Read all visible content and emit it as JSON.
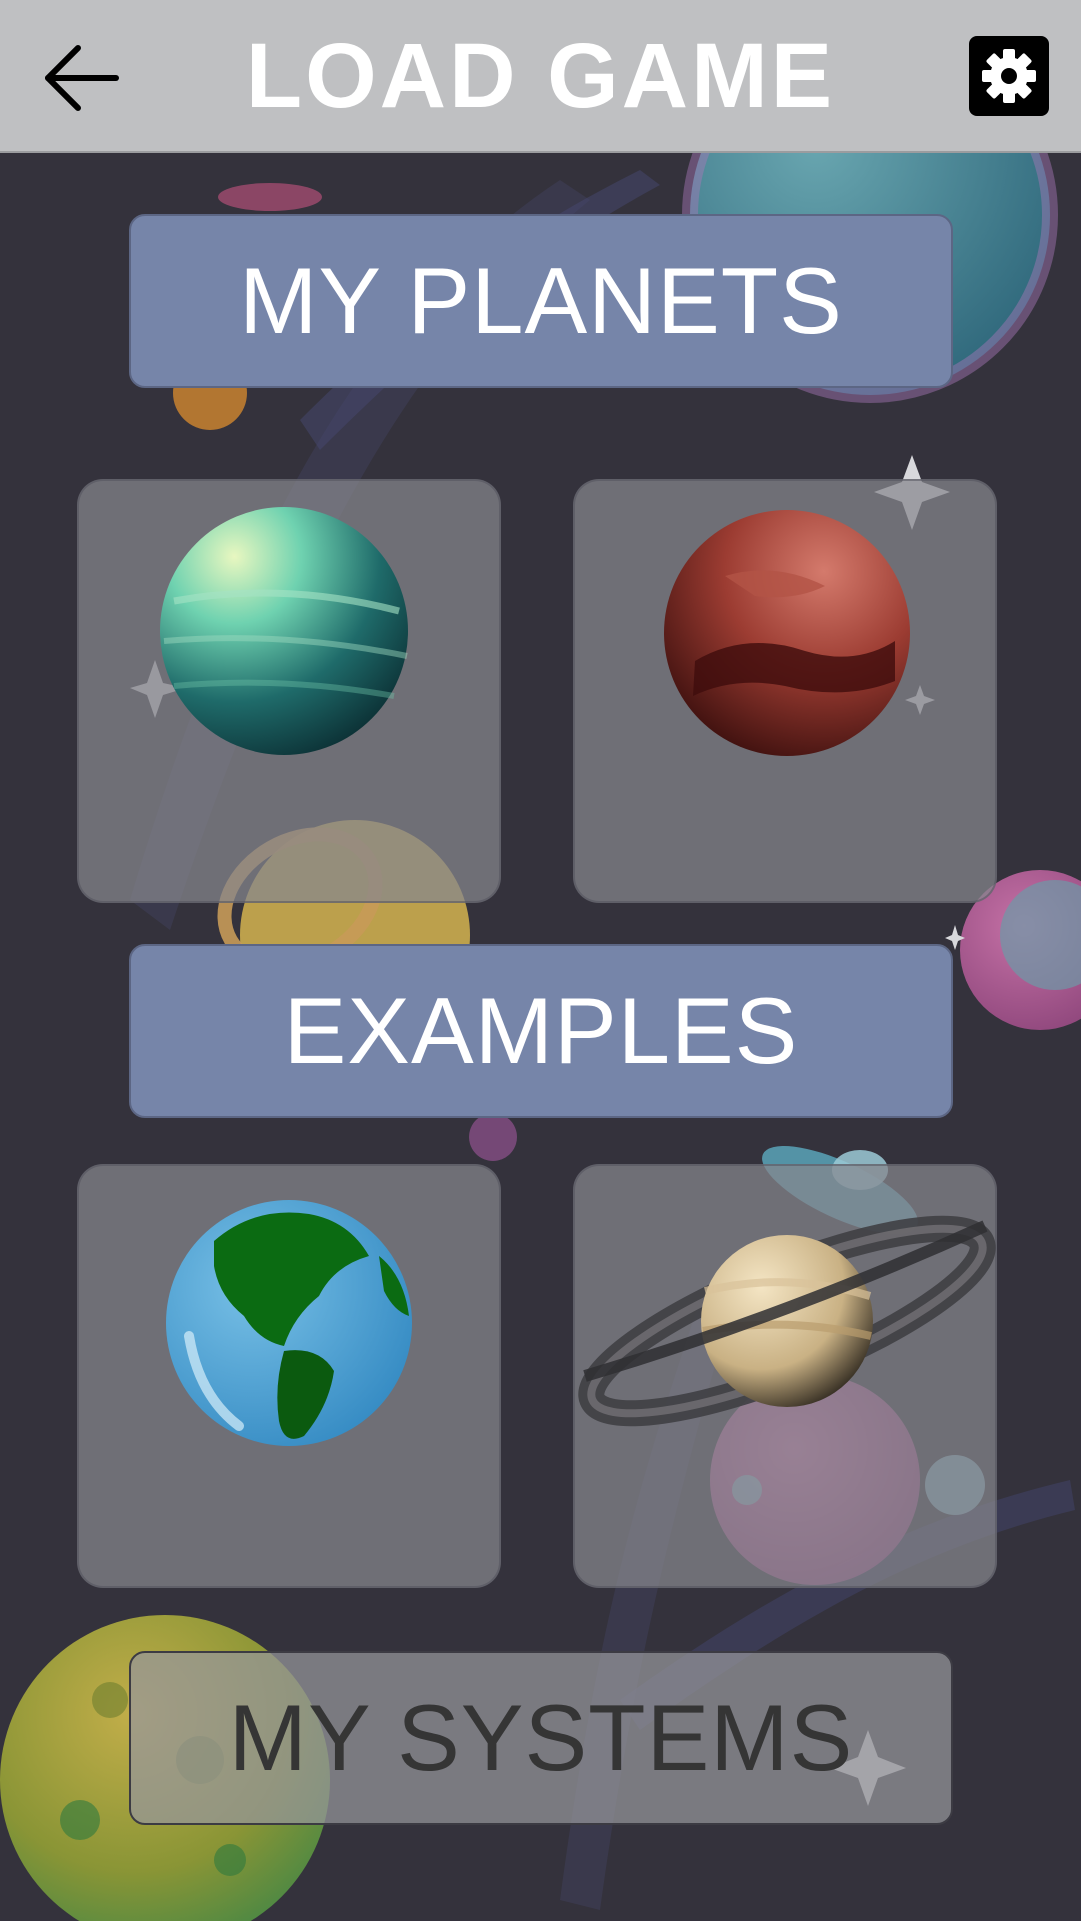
{
  "header": {
    "title": "LOAD GAME",
    "back_icon": "arrow-left-icon",
    "settings_icon": "gear-icon"
  },
  "sections": {
    "my_planets": "MY PLANETS",
    "examples": "EXAMPLES",
    "my_systems": "MY SYSTEMS"
  },
  "my_planets_cards": [
    {
      "icon": "teal-gas-planet-icon"
    },
    {
      "icon": "red-rocky-planet-icon"
    }
  ],
  "example_cards": [
    {
      "icon": "earth-icon"
    },
    {
      "icon": "saturn-icon"
    }
  ],
  "colors": {
    "background": "#34323c",
    "topbar": "#bfc0c2",
    "section_button": "#7685a9",
    "card": "#87878e"
  }
}
